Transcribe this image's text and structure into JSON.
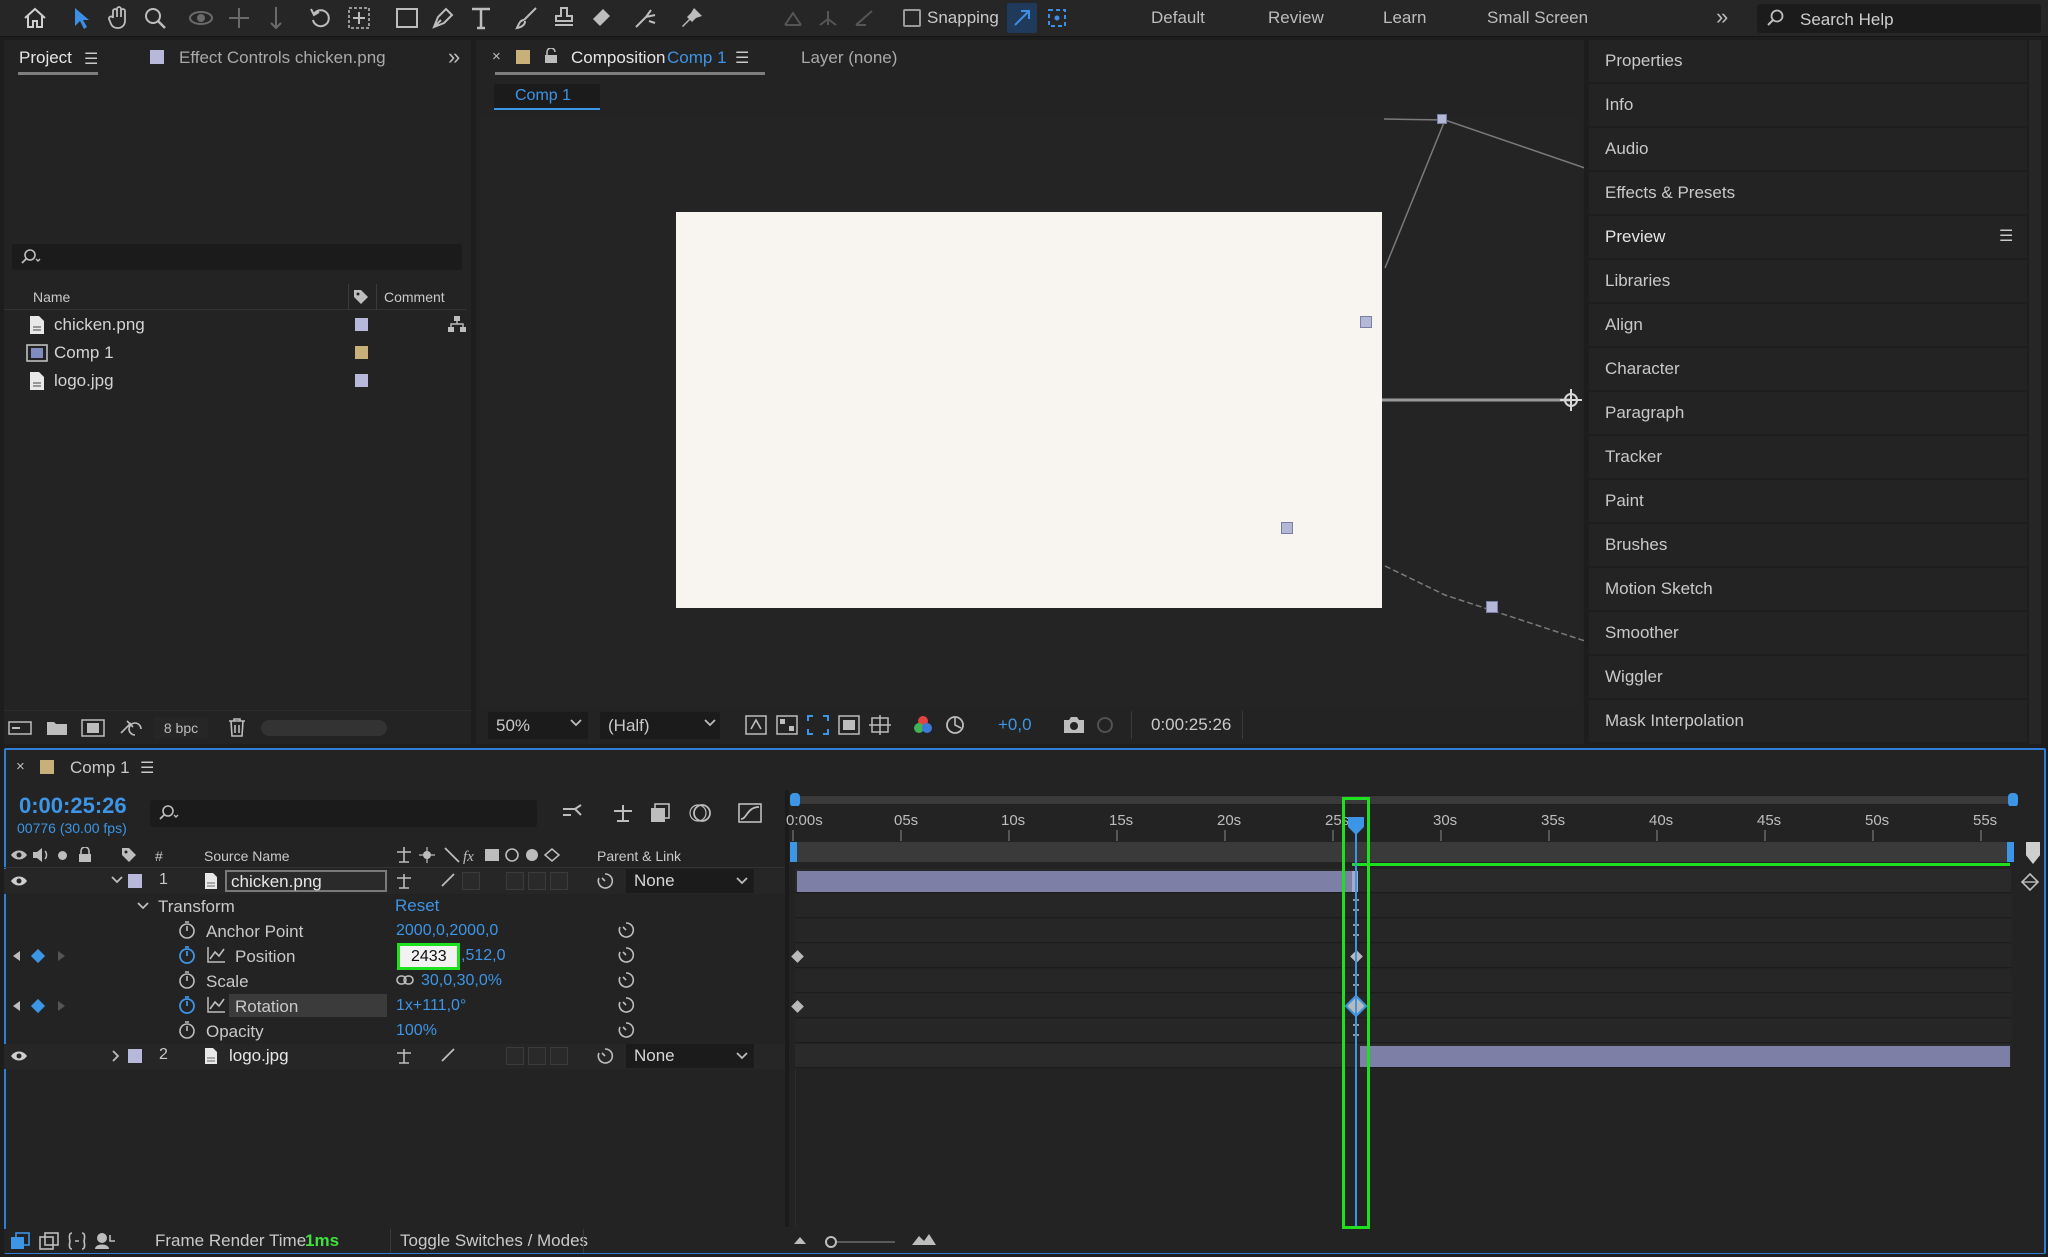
{
  "toolbar": {
    "snapping_label": "Snapping",
    "workspaces": [
      "Default",
      "Review",
      "Learn",
      "Small Screen"
    ],
    "search_placeholder": "Search Help"
  },
  "project": {
    "tab_project": "Project",
    "tab_effect_controls": "Effect Controls chicken.png",
    "col_name": "Name",
    "col_comment": "Comment",
    "items": [
      {
        "name": "chicken.png",
        "label_color": "#b8b9da"
      },
      {
        "name": "Comp 1",
        "label_color": "#c8b07a"
      },
      {
        "name": "logo.jpg",
        "label_color": "#b8b9da"
      }
    ],
    "bpc": "8 bpc"
  },
  "composition": {
    "tab_prefix": "Composition",
    "tab_name": "Comp 1",
    "layer_tab": "Layer (none)",
    "subtab": "Comp 1",
    "zoom": "50%",
    "resolution": "(Half)",
    "exposure": "+0,0",
    "timecode": "0:00:25:26"
  },
  "right_panels": [
    "Properties",
    "Info",
    "Audio",
    "Effects & Presets",
    "Preview",
    "Libraries",
    "Align",
    "Character",
    "Paragraph",
    "Tracker",
    "Paint",
    "Brushes",
    "Motion Sketch",
    "Smoother",
    "Wiggler",
    "Mask Interpolation"
  ],
  "timeline": {
    "tab": "Comp 1",
    "current_time": "0:00:25:26",
    "frame_info": "00776 (30.00 fps)",
    "col_hash": "#",
    "col_source": "Source Name",
    "col_parent": "Parent & Link",
    "ruler_labels": [
      "0:00s",
      "05s",
      "10s",
      "15s",
      "20s",
      "25s",
      "30s",
      "35s",
      "40s",
      "45s",
      "50s",
      "55s"
    ],
    "layer1": {
      "num": "1",
      "name": "chicken.png",
      "parent": "None"
    },
    "layer2": {
      "num": "2",
      "name": "logo.jpg",
      "parent": "None"
    },
    "transform": "Transform",
    "reset": "Reset",
    "props": {
      "anchor_label": "Anchor Point",
      "anchor_value": "2000,0,2000,0",
      "position_label": "Position",
      "position_x": "2433",
      "position_y": ",512,0",
      "scale_label": "Scale",
      "scale_value": "30,0,30,0%",
      "rotation_label": "Rotation",
      "rotation_value": "1x+111,0°",
      "opacity_label": "Opacity",
      "opacity_value": "100%"
    },
    "footer_render_label": "Frame Render Time",
    "footer_render_value": "1ms",
    "footer_toggle": "Toggle Switches / Modes"
  }
}
